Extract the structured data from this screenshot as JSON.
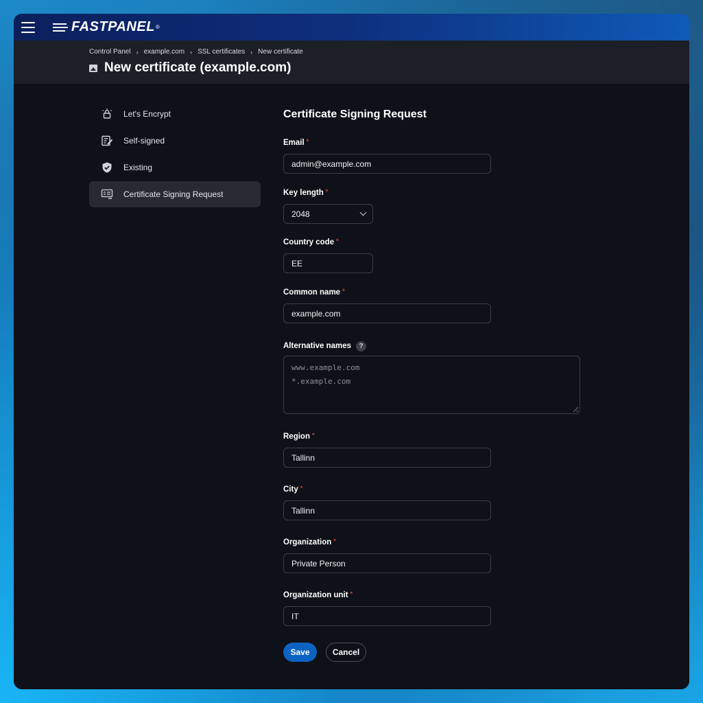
{
  "app": {
    "brand": "FASTPANEL",
    "brand_mark": "®"
  },
  "breadcrumb": [
    "Control Panel",
    "example.com",
    "SSL certificates",
    "New certificate"
  ],
  "page_title": "New certificate (example.com)",
  "sidebar": {
    "items": [
      {
        "label": "Let's Encrypt",
        "icon": "lock-alert-icon",
        "active": false
      },
      {
        "label": "Self-signed",
        "icon": "document-edit-icon",
        "active": false
      },
      {
        "label": "Existing",
        "icon": "shield-check-icon",
        "active": false
      },
      {
        "label": "Certificate Signing Request",
        "icon": "request-list-icon",
        "active": true
      }
    ]
  },
  "form": {
    "title": "Certificate Signing Request",
    "required_mark": "*",
    "email": {
      "label": "Email",
      "value": "admin@example.com"
    },
    "key_length": {
      "label": "Key length",
      "value": "2048"
    },
    "country_code": {
      "label": "Country code",
      "value": "EE"
    },
    "common_name": {
      "label": "Common name",
      "value": "example.com"
    },
    "alternative_names": {
      "label": "Alternative names",
      "help": "?",
      "placeholder_lines": [
        "www.example.com",
        "*.example.com"
      ]
    },
    "region": {
      "label": "Region",
      "value": "Tallinn"
    },
    "city": {
      "label": "City",
      "value": "Tallinn"
    },
    "organization": {
      "label": "Organization",
      "value": "Private Person"
    },
    "organization_unit": {
      "label": "Organization unit",
      "value": "IT"
    },
    "save_label": "Save",
    "cancel_label": "Cancel"
  },
  "colors": {
    "accent": "#0d63c2",
    "required": "#e0413e",
    "background": "#0e1117",
    "header": "#1c1f26"
  }
}
